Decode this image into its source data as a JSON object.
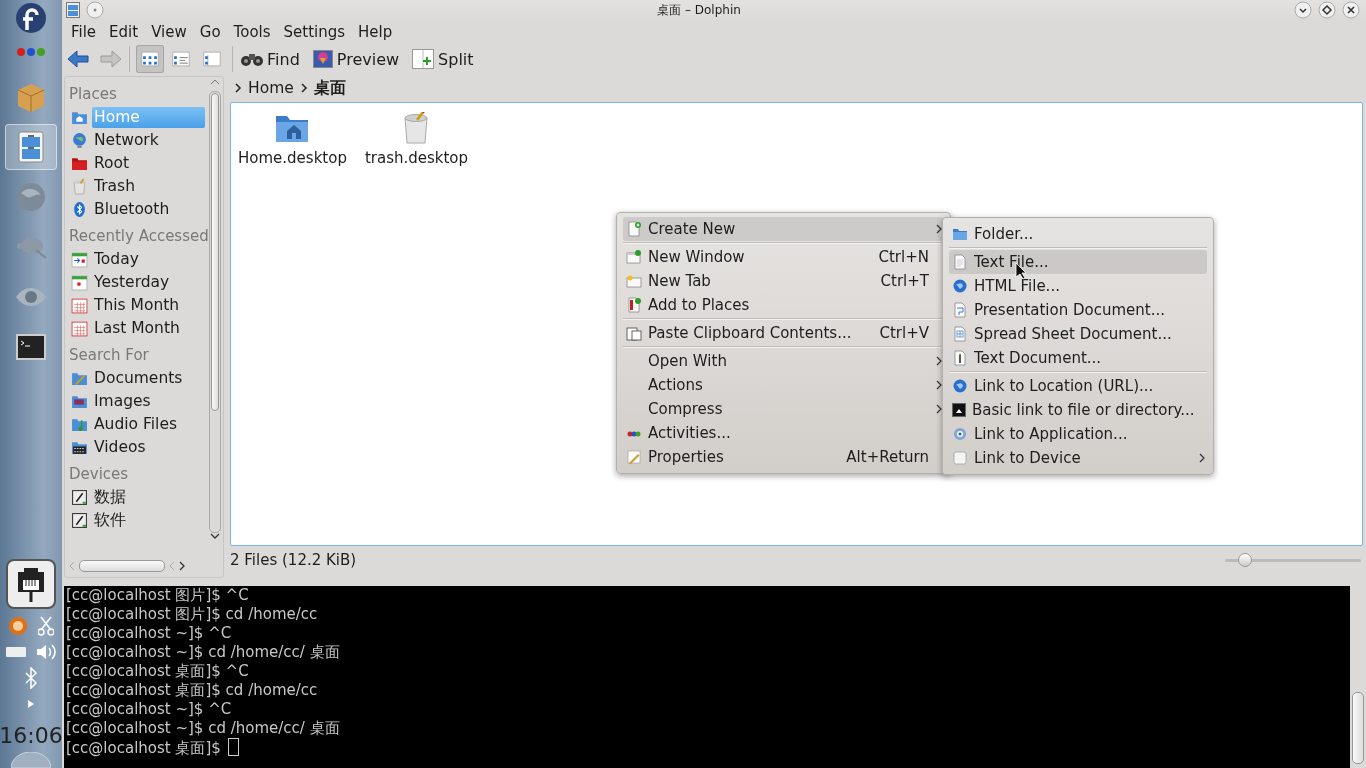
{
  "taskbar": {
    "launchers": [
      {
        "kind": "package",
        "selected": false
      },
      {
        "kind": "file-manager",
        "selected": true
      },
      {
        "kind": "globe",
        "selected": false
      },
      {
        "kind": "gimp",
        "selected": false
      },
      {
        "kind": "eye",
        "selected": false
      },
      {
        "kind": "terminal",
        "selected": false
      }
    ],
    "clock": "16:06"
  },
  "window": {
    "title": "桌面 – Dolphin"
  },
  "menu_bar": [
    "File",
    "Edit",
    "View",
    "Go",
    "Tools",
    "Settings",
    "Help"
  ],
  "view_modes": [
    {
      "kind": "icons",
      "selected": true
    },
    {
      "kind": "details",
      "selected": false
    },
    {
      "kind": "columns",
      "selected": false
    }
  ],
  "toolbar_buttons": [
    {
      "kind": "find",
      "label": "Find"
    },
    {
      "kind": "preview",
      "label": "Preview"
    },
    {
      "kind": "split",
      "label": "Split"
    }
  ],
  "places": [
    {
      "heading": "Places",
      "items": [
        {
          "kind": "home",
          "label": "Home",
          "selected": true
        },
        {
          "kind": "network",
          "label": "Network",
          "selected": false
        },
        {
          "kind": "root",
          "label": "Root",
          "selected": false
        },
        {
          "kind": "trash",
          "label": "Trash",
          "selected": false
        },
        {
          "kind": "bluetooth",
          "label": "Bluetooth",
          "selected": false
        }
      ]
    },
    {
      "heading": "Recently Accessed",
      "items": [
        {
          "kind": "today",
          "label": "Today",
          "selected": false
        },
        {
          "kind": "yesterday",
          "label": "Yesterday",
          "selected": false
        },
        {
          "kind": "month",
          "label": "This Month",
          "selected": false
        },
        {
          "kind": "month",
          "label": "Last Month",
          "selected": false
        }
      ]
    },
    {
      "heading": "Search For",
      "items": [
        {
          "kind": "documents",
          "label": "Documents",
          "selected": false
        },
        {
          "kind": "images",
          "label": "Images",
          "selected": false
        },
        {
          "kind": "audio",
          "label": "Audio Files",
          "selected": false
        },
        {
          "kind": "videos",
          "label": "Videos",
          "selected": false
        }
      ]
    },
    {
      "heading": "Devices",
      "items": [
        {
          "kind": "drive",
          "label": "数据",
          "selected": false
        },
        {
          "kind": "drive",
          "label": "软件",
          "selected": false
        }
      ]
    }
  ],
  "breadcrumb": [
    "Home",
    "桌面"
  ],
  "files": [
    {
      "kind": "home-folder",
      "name": "Home.desktop"
    },
    {
      "kind": "trash",
      "name": "trash.desktop"
    }
  ],
  "status_bar": {
    "text": "2 Files (12.2 KiB)",
    "zoom": {
      "level": 0.15
    }
  },
  "context_menu": [
    {
      "kind": "create",
      "label": "Create New",
      "submenu": true,
      "selected": true
    },
    {
      "kind": "separator"
    },
    {
      "kind": "window",
      "label": "New Window",
      "shortcut": "Ctrl+N",
      "submenu": false,
      "selected": false
    },
    {
      "kind": "tab",
      "label": "New Tab",
      "shortcut": "Ctrl+T",
      "submenu": false,
      "selected": false
    },
    {
      "kind": "places-add",
      "label": "Add to Places",
      "submenu": false,
      "selected": false
    },
    {
      "kind": "separator"
    },
    {
      "kind": "paste",
      "label": "Paste Clipboard Contents...",
      "shortcut": "Ctrl+V",
      "submenu": false,
      "selected": false
    },
    {
      "kind": "separator"
    },
    {
      "kind": "plain",
      "label": "Open With",
      "submenu": true,
      "selected": false
    },
    {
      "kind": "plain",
      "label": "Actions",
      "submenu": true,
      "selected": false
    },
    {
      "kind": "plain",
      "label": "Compress",
      "submenu": true,
      "selected": false
    },
    {
      "kind": "activities",
      "label": "Activities...",
      "submenu": false,
      "selected": false
    },
    {
      "kind": "properties",
      "label": "Properties",
      "shortcut": "Alt+Return",
      "submenu": false,
      "selected": false
    }
  ],
  "create_new_menu": [
    {
      "kind": "folder",
      "label": "Folder...",
      "submenu": false,
      "selected": false
    },
    {
      "kind": "separator"
    },
    {
      "kind": "textfile",
      "label": "Text File...",
      "submenu": false,
      "selected": true
    },
    {
      "kind": "html",
      "label": "HTML File...",
      "submenu": false,
      "selected": false
    },
    {
      "kind": "presentation",
      "label": "Presentation Document...",
      "submenu": false,
      "selected": false
    },
    {
      "kind": "spreadsheet",
      "label": "Spread Sheet Document...",
      "submenu": false,
      "selected": false
    },
    {
      "kind": "textdoc",
      "label": "Text Document...",
      "submenu": false,
      "selected": false
    },
    {
      "kind": "separator"
    },
    {
      "kind": "html",
      "label": "Link to Location (URL)...",
      "submenu": false,
      "selected": false
    },
    {
      "kind": "basic-link",
      "label": "Basic link to file or directory...",
      "submenu": false,
      "selected": false
    },
    {
      "kind": "app",
      "label": "Link to Application...",
      "submenu": false,
      "selected": false
    },
    {
      "kind": "device",
      "label": "Link to Device",
      "submenu": true,
      "selected": false
    }
  ],
  "terminal": [
    "[cc@localhost 图片]$ ^C",
    "[cc@localhost 图片]$ cd /home/cc",
    "[cc@localhost ~]$ ^C",
    "[cc@localhost ~]$ cd /home/cc/ 桌面",
    "[cc@localhost 桌面]$ ^C",
    "[cc@localhost 桌面]$ cd /home/cc",
    "[cc@localhost ~]$ ^C",
    "[cc@localhost ~]$ cd /home/cc/ 桌面",
    "[cc@localhost 桌面]$ "
  ]
}
